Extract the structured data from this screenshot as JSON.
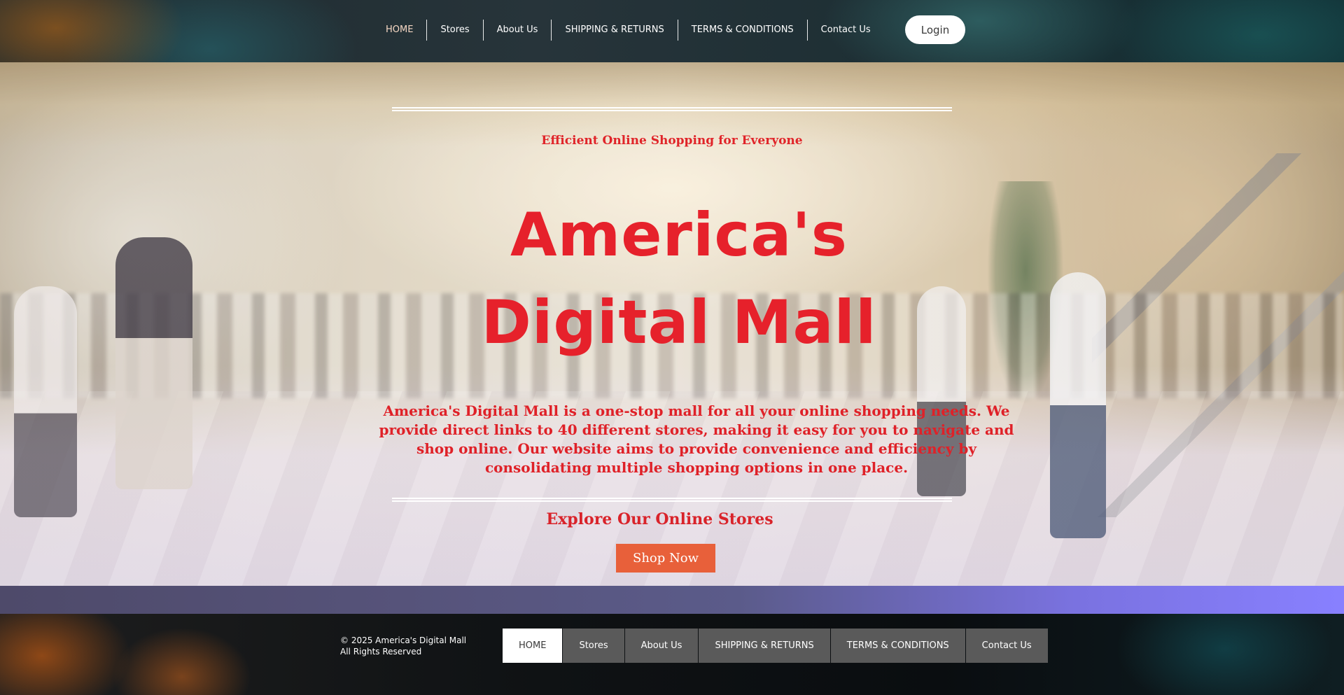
{
  "header": {
    "nav": [
      {
        "label": "HOME",
        "active": true
      },
      {
        "label": "Stores",
        "active": false
      },
      {
        "label": "About Us",
        "active": false
      },
      {
        "label": "SHIPPING & RETURNS",
        "active": false
      },
      {
        "label": "TERMS & CONDITIONS",
        "active": false
      },
      {
        "label": "Contact Us",
        "active": false
      }
    ],
    "login_label": "Login"
  },
  "hero": {
    "tagline": "Efficient Online Shopping for Everyone",
    "title": "America's Digital Mall",
    "description": "America's Digital Mall is a one-stop mall for all your online shopping needs. We provide direct links to 40 different stores, making it easy for you to navigate and shop online. Our website aims to provide convenience and efficiency by consolidating multiple shopping options in one place.",
    "explore_heading": "Explore Our Online Stores",
    "shop_now_label": "Shop Now"
  },
  "footer": {
    "copyright_line1": "© 2025  America's Digital Mall",
    "copyright_line2": "All Rights Reserved",
    "nav": [
      {
        "label": "HOME",
        "active": true
      },
      {
        "label": "Stores",
        "active": false
      },
      {
        "label": "About Us",
        "active": false
      },
      {
        "label": "SHIPPING & RETURNS",
        "active": false
      },
      {
        "label": "TERMS & CONDITIONS",
        "active": false
      },
      {
        "label": "Contact Us",
        "active": false
      }
    ]
  },
  "colors": {
    "title_red": "#e6212b",
    "shop_now_orange": "#e8603a",
    "band_purple": "#8880ff",
    "footer_nav_gray": "#5a5a5a"
  }
}
